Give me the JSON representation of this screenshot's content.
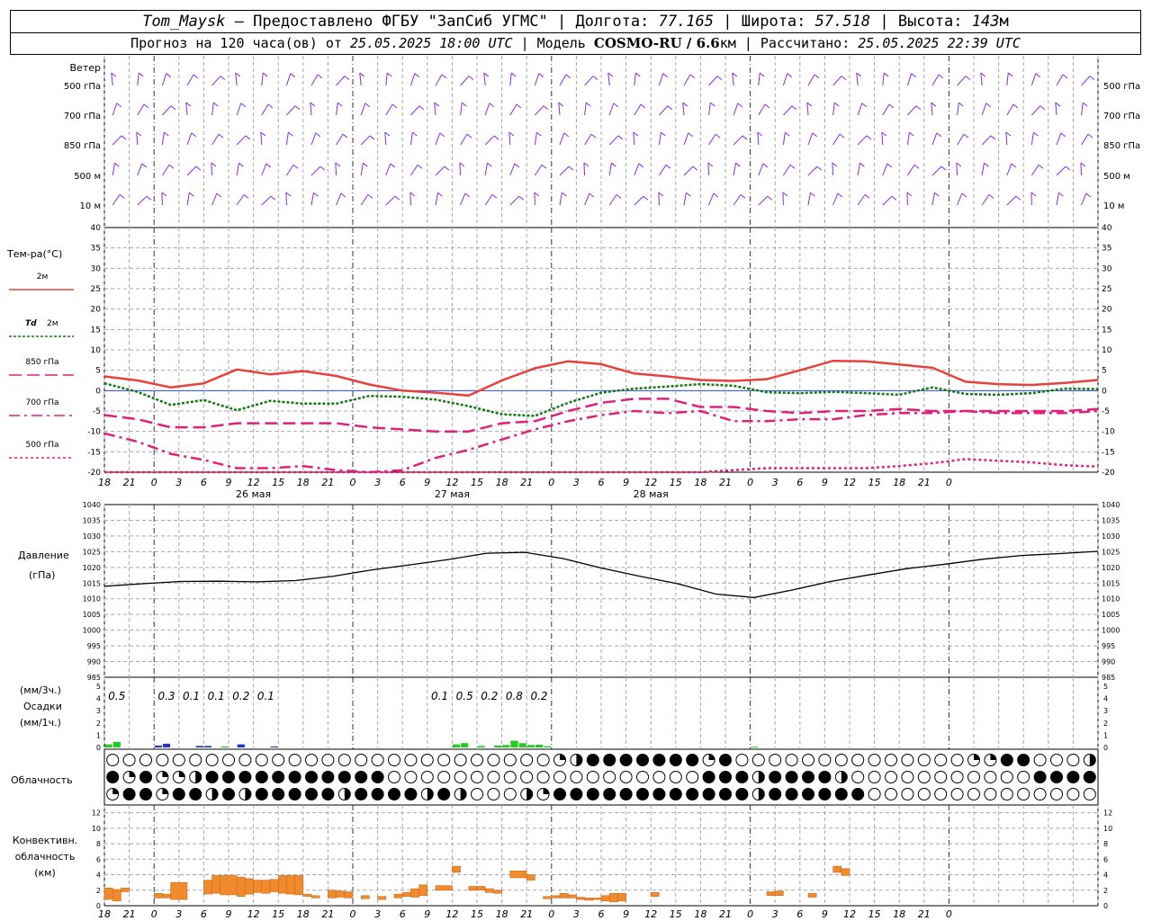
{
  "header": {
    "station": "Tom_Maysk",
    "dash": "–",
    "provided": "Предоставлено ФГБУ \"ЗапСиб УГМС\"",
    "lon_label": "Долгота:",
    "lon": "77.165",
    "lat_label": "Широта:",
    "lat": "57.518",
    "alt_label": "Высота:",
    "alt": "143",
    "alt_unit": "м",
    "forecast_label": "Прогноз на 120 часа(ов) от",
    "forecast_from": "25.05.2025 18:00 UTC",
    "model_label": "Модель",
    "model": "COSMO-RU / 6.6",
    "model_unit": "км",
    "calc_label": "Рассчитано:",
    "calc_time": "25.05.2025 22:39 UTC",
    "sep": "|"
  },
  "colors": {
    "t2m": "#e8403c",
    "td2m": "#147814",
    "t850": "#e0207c",
    "t700": "#e0207c",
    "t500": "#e0207c",
    "wind": "#8a2be2",
    "pressure": "#000000",
    "precip_green": "#22cc22",
    "precip_blue": "#2233cc",
    "convective": "#f08a2c",
    "zero_line": "#2a4ee8",
    "grid": "#a8a8a8"
  },
  "chart_data": [
    {
      "type": "wind_barbs",
      "title": "Ветер",
      "levels": [
        "500 гПа",
        "700 гПа",
        "850 гПа",
        "500 м",
        "10 м"
      ]
    },
    {
      "type": "line",
      "title": "Тем-ра(°С)",
      "legend": [
        "2м",
        "Td 2м",
        "850 гПа",
        "700 гПа",
        "500 гПа"
      ],
      "legend_td_prefix": "Td",
      "legend_td_suffix": "2м",
      "ylim": [
        -20,
        40
      ],
      "yticks": [
        40,
        35,
        30,
        25,
        20,
        15,
        10,
        5,
        0,
        -5,
        -10,
        -15,
        -20
      ],
      "x_hours": [
        0,
        3,
        6,
        9,
        12,
        15,
        18,
        21,
        24,
        27,
        30,
        33,
        36,
        39,
        42,
        45,
        48,
        51,
        54,
        57,
        60,
        63,
        66,
        69,
        72,
        75,
        78,
        81,
        84,
        87,
        90,
        93,
        96,
        99,
        102,
        105,
        108,
        111,
        114,
        117,
        120
      ],
      "xtick_labels": [
        "18",
        "21",
        "0",
        "3",
        "6",
        "9",
        "12",
        "15",
        "18",
        "21",
        "0",
        "3",
        "6",
        "9",
        "12",
        "15",
        "18",
        "21",
        "0",
        "3",
        "6",
        "9",
        "12",
        "15",
        "18",
        "21",
        "0",
        "3",
        "6",
        "9",
        "12",
        "15",
        "18",
        "21",
        "0"
      ],
      "day_labels": [
        "26 мая",
        "27 мая",
        "28 мая"
      ],
      "series": [
        {
          "name": "2м",
          "values": [
            3.5,
            2.5,
            0.8,
            1.8,
            5.2,
            4.0,
            4.8,
            3.6,
            1.5,
            0.0,
            -0.5,
            -1.2,
            2.5,
            5.5,
            7.2,
            6.5,
            4.2,
            3.5,
            2.6,
            2.4,
            2.8,
            5.0,
            7.3,
            7.2,
            6.4,
            5.6,
            2.2,
            1.6,
            1.4,
            1.9,
            2.6
          ]
        },
        {
          "name": "Td 2м",
          "values": [
            1.8,
            -0.3,
            -3.5,
            -2.3,
            -4.8,
            -2.5,
            -3.2,
            -3.2,
            -1.3,
            -1.5,
            -2.2,
            -3.8,
            -5.8,
            -6.2,
            -3.0,
            -0.5,
            0.5,
            1.0,
            1.6,
            1.2,
            -0.4,
            -0.6,
            -0.3,
            -0.6,
            -1.0,
            0.8,
            -0.8,
            -1.0,
            -0.6,
            0.5,
            0.4
          ]
        },
        {
          "name": "850 гПа",
          "values": [
            -6.0,
            -7.0,
            -9.0,
            -9.0,
            -8.0,
            -8.0,
            -8.0,
            -8.0,
            -9.0,
            -9.5,
            -10.0,
            -10.0,
            -8.0,
            -7.5,
            -5.0,
            -3.0,
            -2.0,
            -2.0,
            -4.0,
            -4.0,
            -5.0,
            -5.5,
            -5.0,
            -5.0,
            -4.5,
            -5.0,
            -5.0,
            -5.0,
            -5.0,
            -5.0,
            -4.5
          ]
        },
        {
          "name": "700 гПа",
          "values": [
            -10.5,
            -12.5,
            -15.5,
            -17.0,
            -19.0,
            -19.0,
            -18.5,
            -19.5,
            -21.0,
            -19.5,
            -16.5,
            -14.5,
            -12.0,
            -9.5,
            -7.5,
            -6.0,
            -5.0,
            -5.5,
            -5.0,
            -7.5,
            -7.5,
            -7.0,
            -7.0,
            -6.0,
            -5.5,
            -5.5,
            -5.0,
            -5.5,
            -5.5,
            -5.5,
            -5.0
          ]
        },
        {
          "name": "500 гПа",
          "values": [
            -23.0,
            -23.0,
            -23.0,
            -23.0,
            -23.0,
            -23.0,
            -23.0,
            -23.0,
            -23.0,
            -23.0,
            -23.0,
            -23.0,
            -23.0,
            -23.0,
            -23.0,
            -23.0,
            -23.0,
            -22.0,
            -21.0,
            -19.5,
            -19.0,
            -19.0,
            -19.0,
            -19.0,
            -18.5,
            -17.8,
            -16.8,
            -17.2,
            -17.6,
            -18.3,
            -18.6
          ]
        }
      ]
    },
    {
      "type": "line",
      "title": "Давление",
      "unit": "(гПа)",
      "ylim": [
        985,
        1040
      ],
      "yticks": [
        1040,
        1035,
        1030,
        1025,
        1020,
        1015,
        1010,
        1005,
        1000,
        995,
        990,
        985
      ],
      "series": [
        {
          "name": "Давление",
          "values": [
            1014,
            1014.8,
            1015.5,
            1015.6,
            1015.4,
            1015.8,
            1017.2,
            1019.2,
            1020.8,
            1022.5,
            1024.5,
            1024.8,
            1022.8,
            1019.8,
            1017.2,
            1014.8,
            1011.5,
            1010.4,
            1012.8,
            1015.5,
            1017.6,
            1019.6,
            1021.0,
            1022.6,
            1023.8,
            1024.4,
            1025.1
          ]
        }
      ]
    },
    {
      "type": "bar",
      "title": "Осадки",
      "unit_3h": "(мм/3ч.)",
      "unit_1h": "(мм/1ч.)",
      "ylim": [
        0,
        5
      ],
      "yticks": [
        5,
        4,
        3,
        2,
        1,
        0
      ],
      "totals": [
        {
          "hour": 1.5,
          "label": "0.5"
        },
        {
          "hour": 7.5,
          "label": "0.3"
        },
        {
          "hour": 10.5,
          "label": "0.1"
        },
        {
          "hour": 13.5,
          "label": "0.1"
        },
        {
          "hour": 16.5,
          "label": "0.2"
        },
        {
          "hour": 19.5,
          "label": "0.1"
        },
        {
          "hour": 40.5,
          "label": "0.1"
        },
        {
          "hour": 43.5,
          "label": "0.5"
        },
        {
          "hour": 46.5,
          "label": "0.2"
        },
        {
          "hour": 49.5,
          "label": "0.8"
        },
        {
          "hour": 52.5,
          "label": "0.2"
        }
      ],
      "bars": [
        {
          "hour": 0.5,
          "value": 0.25,
          "kind": "green"
        },
        {
          "hour": 1.5,
          "value": 0.45,
          "kind": "green"
        },
        {
          "hour": 6.5,
          "value": 0.15,
          "kind": "blue"
        },
        {
          "hour": 7.5,
          "value": 0.3,
          "kind": "blue"
        },
        {
          "hour": 11.5,
          "value": 0.12,
          "kind": "blue"
        },
        {
          "hour": 12.5,
          "value": 0.12,
          "kind": "blue"
        },
        {
          "hour": 14.5,
          "value": 0.08,
          "kind": "green"
        },
        {
          "hour": 16.5,
          "value": 0.25,
          "kind": "blue"
        },
        {
          "hour": 20.5,
          "value": 0.08,
          "kind": "blue"
        },
        {
          "hour": 42.5,
          "value": 0.25,
          "kind": "green"
        },
        {
          "hour": 43.5,
          "value": 0.35,
          "kind": "green"
        },
        {
          "hour": 45.5,
          "value": 0.12,
          "kind": "green"
        },
        {
          "hour": 47.5,
          "value": 0.15,
          "kind": "green"
        },
        {
          "hour": 48.5,
          "value": 0.2,
          "kind": "green"
        },
        {
          "hour": 49.5,
          "value": 0.55,
          "kind": "green"
        },
        {
          "hour": 50.5,
          "value": 0.35,
          "kind": "green"
        },
        {
          "hour": 51.5,
          "value": 0.2,
          "kind": "green"
        },
        {
          "hour": 52.5,
          "value": 0.22,
          "kind": "green"
        },
        {
          "hour": 53.5,
          "value": 0.1,
          "kind": "green"
        },
        {
          "hour": 78.5,
          "value": 0.06,
          "kind": "green"
        }
      ]
    },
    {
      "type": "cloud_cover",
      "title": "Облачность",
      "rows": 3,
      "symbols_per_row": 40,
      "note": "circle symbols: open = clear, filled = overcast, half = partial"
    },
    {
      "type": "bar",
      "title": "Конвективн. облачность (км)",
      "title_lines": [
        "Конвективн.",
        "облачность",
        "(км)"
      ],
      "ylim": [
        0,
        13
      ],
      "yticks": [
        12,
        10,
        8,
        6,
        4,
        2,
        0
      ],
      "segments": [
        {
          "start": 0,
          "end": 1,
          "bottom": 0.8,
          "top": 2.3
        },
        {
          "start": 1,
          "end": 2,
          "bottom": 0.6,
          "top": 2.1
        },
        {
          "start": 2,
          "end": 3,
          "bottom": 1.8,
          "top": 2.3
        },
        {
          "start": 6,
          "end": 7,
          "bottom": 1.0,
          "top": 1.6
        },
        {
          "start": 7,
          "end": 8,
          "bottom": 1.0,
          "top": 1.5
        },
        {
          "start": 8,
          "end": 10,
          "bottom": 0.8,
          "top": 3.0
        },
        {
          "start": 12,
          "end": 13,
          "bottom": 1.5,
          "top": 3.3
        },
        {
          "start": 13,
          "end": 14,
          "bottom": 1.6,
          "top": 3.9
        },
        {
          "start": 14,
          "end": 16,
          "bottom": 1.4,
          "top": 3.9
        },
        {
          "start": 16,
          "end": 17,
          "bottom": 1.2,
          "top": 3.7
        },
        {
          "start": 17,
          "end": 18,
          "bottom": 1.5,
          "top": 3.5
        },
        {
          "start": 18,
          "end": 19,
          "bottom": 1.7,
          "top": 3.3
        },
        {
          "start": 19,
          "end": 20,
          "bottom": 1.6,
          "top": 3.3
        },
        {
          "start": 20,
          "end": 21,
          "bottom": 1.8,
          "top": 3.4
        },
        {
          "start": 21,
          "end": 22,
          "bottom": 1.6,
          "top": 3.9
        },
        {
          "start": 22,
          "end": 23,
          "bottom": 1.5,
          "top": 3.9
        },
        {
          "start": 23,
          "end": 24,
          "bottom": 1.4,
          "top": 3.9
        },
        {
          "start": 24,
          "end": 25,
          "bottom": 1.2,
          "top": 1.5
        },
        {
          "start": 25,
          "end": 26,
          "bottom": 1.0,
          "top": 1.3
        },
        {
          "start": 27,
          "end": 28,
          "bottom": 1.0,
          "top": 2.0
        },
        {
          "start": 28,
          "end": 29,
          "bottom": 1.1,
          "top": 1.9
        },
        {
          "start": 29,
          "end": 30,
          "bottom": 1.0,
          "top": 1.8
        },
        {
          "start": 31,
          "end": 32,
          "bottom": 0.9,
          "top": 1.3
        },
        {
          "start": 33,
          "end": 34,
          "bottom": 0.8,
          "top": 1.2
        },
        {
          "start": 35,
          "end": 36,
          "bottom": 1.0,
          "top": 1.5
        },
        {
          "start": 36,
          "end": 37,
          "bottom": 1.2,
          "top": 1.7
        },
        {
          "start": 37,
          "end": 38,
          "bottom": 1.1,
          "top": 2.2
        },
        {
          "start": 38,
          "end": 39,
          "bottom": 1.3,
          "top": 2.7
        },
        {
          "start": 40,
          "end": 42,
          "bottom": 2.0,
          "top": 2.6
        },
        {
          "start": 42,
          "end": 43,
          "bottom": 4.3,
          "top": 5.1
        },
        {
          "start": 44,
          "end": 45,
          "bottom": 2.0,
          "top": 2.5
        },
        {
          "start": 45,
          "end": 46,
          "bottom": 2.0,
          "top": 2.5
        },
        {
          "start": 46,
          "end": 47,
          "bottom": 1.7,
          "top": 2.2
        },
        {
          "start": 47,
          "end": 48,
          "bottom": 1.6,
          "top": 2.0
        },
        {
          "start": 49,
          "end": 51,
          "bottom": 3.6,
          "top": 4.5
        },
        {
          "start": 51,
          "end": 52,
          "bottom": 3.3,
          "top": 4.0
        },
        {
          "start": 53,
          "end": 54,
          "bottom": 0.9,
          "top": 1.2
        },
        {
          "start": 54,
          "end": 55,
          "bottom": 1.0,
          "top": 1.3
        },
        {
          "start": 55,
          "end": 56,
          "bottom": 1.0,
          "top": 1.6
        },
        {
          "start": 56,
          "end": 57,
          "bottom": 1.0,
          "top": 1.4
        },
        {
          "start": 57,
          "end": 58,
          "bottom": 0.8,
          "top": 1.1
        },
        {
          "start": 58,
          "end": 59,
          "bottom": 0.7,
          "top": 1.0
        },
        {
          "start": 59,
          "end": 60,
          "bottom": 0.8,
          "top": 1.0
        },
        {
          "start": 60,
          "end": 61,
          "bottom": 0.6,
          "top": 1.3
        },
        {
          "start": 61,
          "end": 62,
          "bottom": 0.5,
          "top": 1.6
        },
        {
          "start": 62,
          "end": 63,
          "bottom": 0.6,
          "top": 1.6
        },
        {
          "start": 66,
          "end": 67,
          "bottom": 1.2,
          "top": 1.7
        },
        {
          "start": 80,
          "end": 81,
          "bottom": 1.3,
          "top": 1.8
        },
        {
          "start": 81,
          "end": 82,
          "bottom": 1.3,
          "top": 1.9
        },
        {
          "start": 85,
          "end": 86,
          "bottom": 1.1,
          "top": 1.6
        },
        {
          "start": 88,
          "end": 89,
          "bottom": 4.3,
          "top": 5.1
        },
        {
          "start": 89,
          "end": 90,
          "bottom": 3.9,
          "top": 4.8
        }
      ]
    }
  ]
}
